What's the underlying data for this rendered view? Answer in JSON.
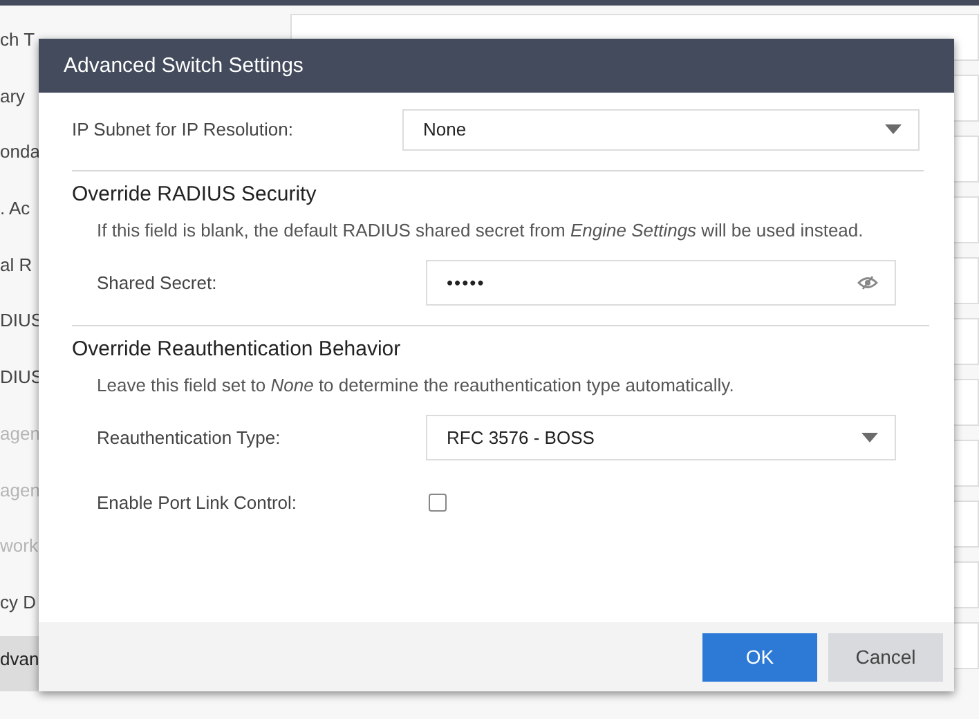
{
  "background": {
    "sidebar_items": [
      {
        "label": "ch T",
        "disabled": false,
        "selected": false
      },
      {
        "label": "ary",
        "disabled": false,
        "selected": false
      },
      {
        "label": "onda",
        "disabled": false,
        "selected": false
      },
      {
        "label": ". Ac",
        "disabled": false,
        "selected": false
      },
      {
        "label": "al R",
        "disabled": false,
        "selected": false
      },
      {
        "label": "DIUS",
        "disabled": false,
        "selected": false
      },
      {
        "label": "DIUS",
        "disabled": false,
        "selected": false
      },
      {
        "label": "agen",
        "disabled": true,
        "selected": false
      },
      {
        "label": "agen",
        "disabled": true,
        "selected": false
      },
      {
        "label": "work",
        "disabled": true,
        "selected": false
      },
      {
        "label": "cy D",
        "disabled": false,
        "selected": false
      },
      {
        "label": "dvan",
        "disabled": false,
        "selected": true
      }
    ]
  },
  "dialog": {
    "title": "Advanced Switch Settings",
    "ip_subnet": {
      "label": "IP Subnet for IP Resolution:",
      "value": "None"
    },
    "sections": [
      {
        "heading": "Override RADIUS Security",
        "note": "If this field is blank, the default RADIUS shared secret from *Engine Settings* will be used instead.",
        "fields": [
          {
            "kind": "password",
            "label": "Shared Secret:",
            "value": "•••••"
          }
        ]
      },
      {
        "heading": "Override Reauthentication Behavior",
        "note": "Leave this field set to *None* to determine the reauthentication type automatically.",
        "fields": [
          {
            "kind": "select",
            "label": "Reauthentication Type:",
            "value": "RFC 3576 - BOSS"
          },
          {
            "kind": "checkbox",
            "label": "Enable Port Link Control:",
            "checked": false
          }
        ]
      }
    ],
    "buttons": [
      {
        "label": "OK",
        "kind": "primary"
      },
      {
        "label": "Cancel",
        "kind": "secondary"
      }
    ]
  }
}
